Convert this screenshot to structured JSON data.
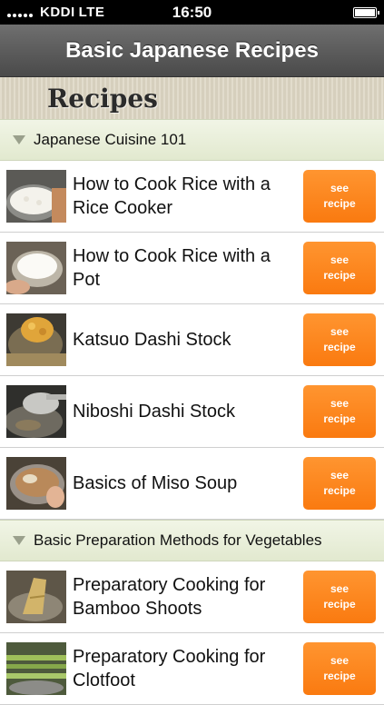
{
  "status_bar": {
    "carrier": "KDDI",
    "network": "LTE",
    "time": "16:50"
  },
  "nav": {
    "title": "Basic Japanese Recipes"
  },
  "section": {
    "title": "Recipes"
  },
  "categories": [
    {
      "label": "Japanese Cuisine 101",
      "items": [
        {
          "title": "How to Cook Rice with a Rice Cooker",
          "button_line1": "see",
          "button_line2": "recipe",
          "thumb": "rice-cooker"
        },
        {
          "title": "How to Cook Rice with a Pot",
          "button_line1": "see",
          "button_line2": "recipe",
          "thumb": "rice-bowl"
        },
        {
          "title": "Katsuo Dashi Stock",
          "button_line1": "see",
          "button_line2": "recipe",
          "thumb": "katsuo"
        },
        {
          "title": "Niboshi Dashi Stock",
          "button_line1": "see",
          "button_line2": "recipe",
          "thumb": "niboshi"
        },
        {
          "title": "Basics of Miso Soup",
          "button_line1": "see",
          "button_line2": "recipe",
          "thumb": "miso"
        }
      ]
    },
    {
      "label": "Basic Preparation Methods for Vegetables",
      "items": [
        {
          "title": "Preparatory Cooking for Bamboo Shoots",
          "button_line1": "see",
          "button_line2": "recipe",
          "thumb": "bamboo"
        },
        {
          "title": "Preparatory Cooking for Clotfoot",
          "button_line1": "see",
          "button_line2": "recipe",
          "thumb": "clotfoot"
        }
      ]
    }
  ],
  "colors": {
    "accent": "#fa7a10",
    "navbar": "#555555",
    "category_bg": "#e9efd8"
  }
}
